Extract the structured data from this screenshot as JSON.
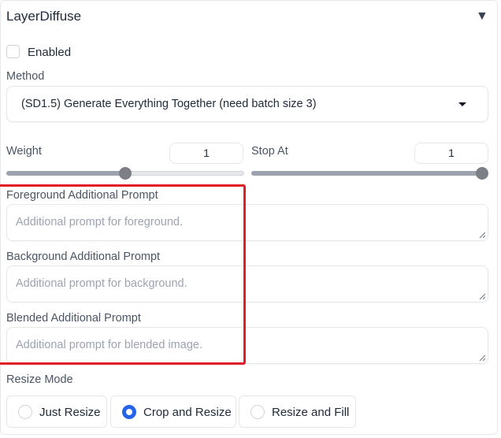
{
  "panel": {
    "title": "LayerDiffuse"
  },
  "enabled": {
    "label": "Enabled",
    "checked": false
  },
  "method": {
    "label": "Method",
    "selected": "(SD1.5) Generate Everything Together (need batch size 3)"
  },
  "weight": {
    "label": "Weight",
    "value": "1",
    "fill": 0.5
  },
  "stop_at": {
    "label": "Stop At",
    "value": "1",
    "fill": 1.0
  },
  "foreground": {
    "label": "Foreground Additional Prompt",
    "placeholder": "Additional prompt for foreground."
  },
  "background": {
    "label": "Background Additional Prompt",
    "placeholder": "Additional prompt for background."
  },
  "blended": {
    "label": "Blended Additional Prompt",
    "placeholder": "Additional prompt for blended image."
  },
  "resize_mode": {
    "label": "Resize Mode",
    "options": [
      "Just Resize",
      "Crop and Resize",
      "Resize and Fill"
    ],
    "selected": "Crop and Resize"
  },
  "colors": {
    "accent": "#2563eb",
    "highlight": "#e11d2a",
    "slider": "#7c7f86"
  }
}
